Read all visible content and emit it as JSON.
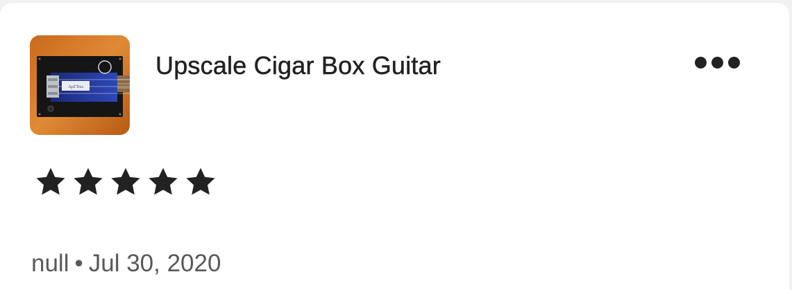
{
  "review": {
    "listing_title": "Upscale Cigar Box Guitar",
    "thumbnail_label": "Ayd Tres",
    "rating": 5,
    "rating_max": 5,
    "reviewer": "null",
    "separator": "•",
    "date": "Jul 30, 2020"
  },
  "icons": {
    "more": "more-horizontal-icon",
    "star": "star-icon"
  },
  "colors": {
    "text_primary": "#222222",
    "text_secondary": "#595959",
    "star": "#222222",
    "background": "#ffffff"
  }
}
